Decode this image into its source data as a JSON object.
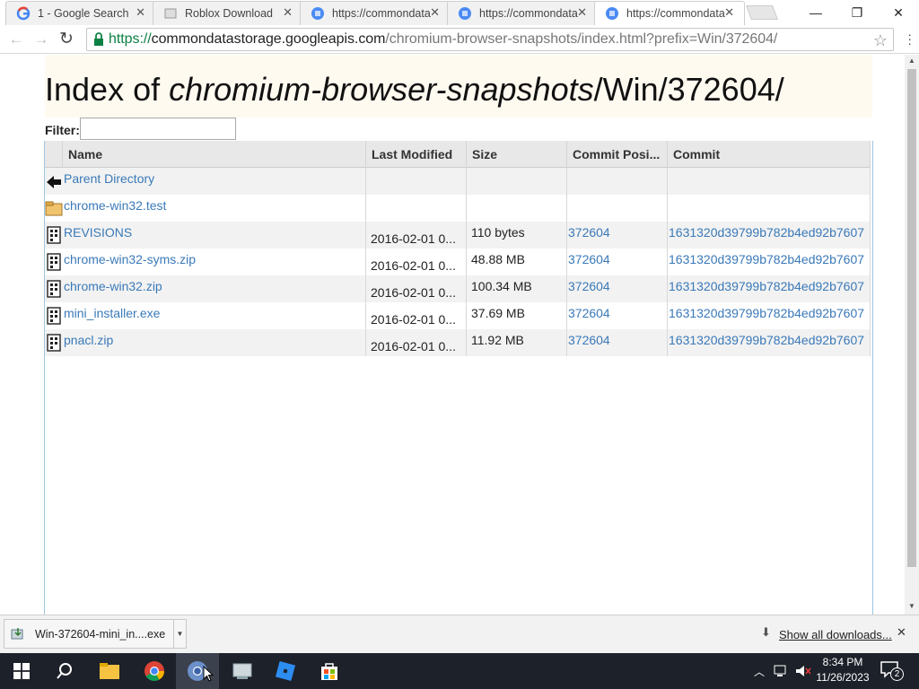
{
  "tabs": [
    {
      "title": "1 - Google Search",
      "favicon": "google-icon"
    },
    {
      "title": "Roblox Download",
      "favicon": "page-icon"
    },
    {
      "title": "https://commondata",
      "favicon": "globe-icon"
    },
    {
      "title": "https://commondata",
      "favicon": "globe-icon"
    },
    {
      "title": "https://commondata",
      "favicon": "globe-icon",
      "active": true
    }
  ],
  "address": {
    "scheme": "https://",
    "host": "commondatastorage.googleapis.com",
    "path": "/chromium-browser-snapshots/index.html?prefix=Win/372604/"
  },
  "page": {
    "title_prefix": "Index of ",
    "title_italic": "chromium-browser-snapshots",
    "title_suffix": "/Win/372604/",
    "filter_label": "Filter:",
    "filter_value": ""
  },
  "table": {
    "headers": [
      "Name",
      "Last Modified",
      "Size",
      "Commit Posi...",
      "Commit"
    ],
    "rows": [
      {
        "icon": "parent-directory-icon",
        "name": "Parent Directory",
        "modified": "",
        "size": "",
        "position": "",
        "commit": ""
      },
      {
        "icon": "folder-icon",
        "name": "chrome-win32.test",
        "modified": "",
        "size": "",
        "position": "",
        "commit": ""
      },
      {
        "icon": "file-icon",
        "name": "REVISIONS",
        "modified": "2016-02-01 0...",
        "size": "110 bytes",
        "position": "372604",
        "commit": "1631320d39799b782b4ed92b7607"
      },
      {
        "icon": "file-icon",
        "name": "chrome-win32-syms.zip",
        "modified": "2016-02-01 0...",
        "size": "48.88 MB",
        "position": "372604",
        "commit": "1631320d39799b782b4ed92b7607"
      },
      {
        "icon": "file-icon",
        "name": "chrome-win32.zip",
        "modified": "2016-02-01 0...",
        "size": "100.34 MB",
        "position": "372604",
        "commit": "1631320d39799b782b4ed92b7607"
      },
      {
        "icon": "file-icon",
        "name": "mini_installer.exe",
        "modified": "2016-02-01 0...",
        "size": "37.69 MB",
        "position": "372604",
        "commit": "1631320d39799b782b4ed92b7607"
      },
      {
        "icon": "file-icon",
        "name": "pnacl.zip",
        "modified": "2016-02-01 0...",
        "size": "11.92 MB",
        "position": "372604",
        "commit": "1631320d39799b782b4ed92b7607"
      }
    ]
  },
  "downloads": {
    "item_name": "Win-372604-mini_in....exe",
    "show_all": "Show all downloads..."
  },
  "taskbar": {
    "time": "8:34 PM",
    "date": "11/26/2023",
    "notification_count": "2"
  },
  "colors": {
    "link": "#3a79b8",
    "secure": "#0b8043",
    "taskbar": "#1d2129"
  }
}
